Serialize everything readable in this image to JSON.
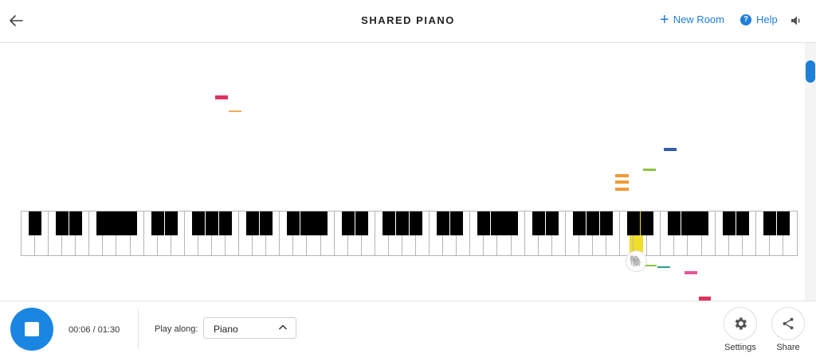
{
  "header": {
    "title": "SHARED PIANO",
    "new_room_label": "New Room",
    "help_label": "Help",
    "back_icon": "arrow-left-icon",
    "sound_icon": "speaker-icon"
  },
  "footer": {
    "time": "00:06 / 01:30",
    "play_along_label": "Play along:",
    "instrument": "Piano",
    "settings_label": "Settings",
    "share_label": "Share"
  },
  "colors": {
    "accent": "#1f7ed6",
    "highlight": "#f1de2b",
    "note_red": "#e0325c",
    "note_orange": "#f19a38",
    "note_blue": "#3260a8",
    "note_green": "#8cc63f",
    "note_pink": "#e8549a",
    "note_teal": "#2a9d8f"
  }
}
